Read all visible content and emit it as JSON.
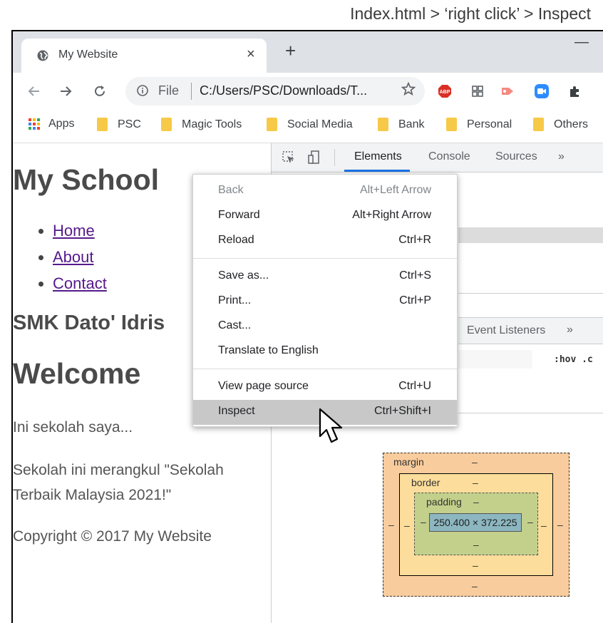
{
  "caption": "Index.html > ‘right click’ > Inspect",
  "browser": {
    "tab_title": "My Website",
    "tab_close": "×",
    "new_tab": "+",
    "minimize": "—",
    "url_scheme": "File",
    "url": "C:/Users/PSC/Downloads/T...",
    "bookmarks": [
      "Apps",
      "PSC",
      "Magic Tools",
      "Social Media",
      "Bank",
      "Personal",
      "Others"
    ],
    "colors": {
      "tabstrip": "#dee1e6",
      "omnibox": "#f1f3f4",
      "folder": "#f7c948"
    }
  },
  "page": {
    "h1": "My School",
    "nav": [
      "Home",
      "About",
      "Contact"
    ],
    "h3": "SMK Dato' Idris",
    "h2": "Welcome",
    "p1": "Ini sekolah saya...",
    "p2_line1": "Sekolah ini merangkul \"Sekolah",
    "p2_line2": "Terbaik Malaysia 2021!\"",
    "footer": "Copyright © 2017 My Website"
  },
  "devtools": {
    "tabs": [
      "Elements",
      "Console",
      "Sources",
      "»"
    ],
    "sub_tabs": [
      "Event Listeners",
      "»"
    ],
    "hov": ":hov .c",
    "box_model": {
      "margin_label": "margin",
      "border_label": "border",
      "padding_label": "padding",
      "dash": "–",
      "content_size": "250.400 × 372.225"
    }
  },
  "context_menu": {
    "groups": [
      [
        {
          "label": "Back",
          "shortcut": "Alt+Left Arrow",
          "disabled": true
        },
        {
          "label": "Forward",
          "shortcut": "Alt+Right Arrow"
        },
        {
          "label": "Reload",
          "shortcut": "Ctrl+R"
        }
      ],
      [
        {
          "label": "Save as...",
          "shortcut": "Ctrl+S"
        },
        {
          "label": "Print...",
          "shortcut": "Ctrl+P"
        },
        {
          "label": "Cast...",
          "shortcut": ""
        },
        {
          "label": "Translate to English",
          "shortcut": ""
        }
      ],
      [
        {
          "label": "View page source",
          "shortcut": "Ctrl+U"
        },
        {
          "label": "Inspect",
          "shortcut": "Ctrl+Shift+I",
          "highlighted": true
        }
      ]
    ]
  }
}
